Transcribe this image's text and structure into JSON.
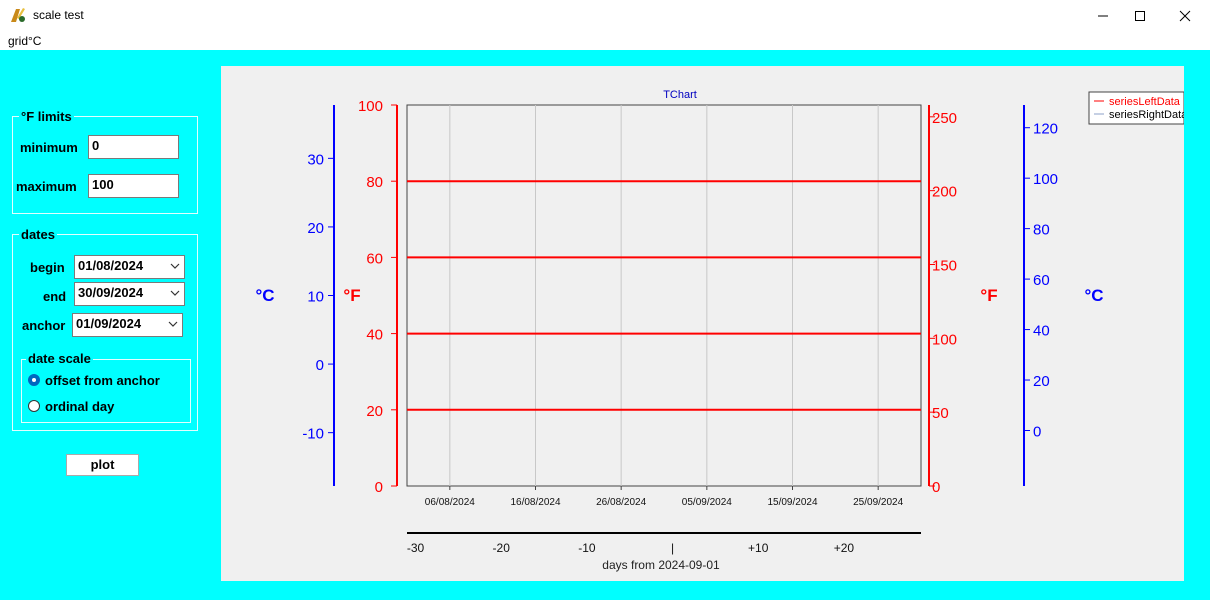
{
  "window": {
    "title": "scale test"
  },
  "menu": {
    "item": "grid°C"
  },
  "f_limits": {
    "legend": "°F limits",
    "minimum_label": "minimum",
    "minimum_value": "0",
    "maximum_label": "maximum",
    "maximum_value": "100"
  },
  "dates": {
    "legend": "dates",
    "begin_label": "begin",
    "begin_value": "01/08/2024",
    "end_label": "end",
    "end_value": "30/09/2024",
    "anchor_label": "anchor",
    "anchor_value": "01/09/2024"
  },
  "date_scale": {
    "legend": "date scale",
    "options": [
      "offset from anchor",
      "ordinal day"
    ],
    "selected": "offset from anchor"
  },
  "plot_button": "plot",
  "colors": {
    "background": "#00ffff",
    "fahrenheit": "#ff0000",
    "celsius": "#0000ff"
  },
  "chart_data": {
    "type": "line",
    "title": "TChart",
    "left_axes": [
      {
        "label": "°C",
        "ticks": [
          30,
          20,
          10,
          0,
          -10
        ],
        "color": "#0000ff"
      },
      {
        "label": "°F",
        "ticks": [
          100,
          80,
          60,
          40,
          20,
          0
        ],
        "range": [
          0,
          100
        ],
        "color": "#ff0000"
      }
    ],
    "right_axes": [
      {
        "label": "°F",
        "ticks": [
          250,
          200,
          150,
          100,
          50,
          0
        ],
        "color": "#ff0000"
      },
      {
        "label": "°C",
        "ticks": [
          120,
          100,
          80,
          60,
          40,
          20,
          0
        ],
        "color": "#0000ff"
      }
    ],
    "x_dates": [
      "06/08/2024",
      "16/08/2024",
      "26/08/2024",
      "05/09/2024",
      "15/09/2024",
      "25/09/2024"
    ],
    "x_range": [
      "01/08/2024",
      "30/09/2024"
    ],
    "horizontal_lines_F": [
      80,
      60,
      40,
      20
    ],
    "offset_axis": {
      "ticks": [
        "-30",
        "-20",
        "-10",
        "|",
        "+10",
        "+20"
      ],
      "label": "days from 2024-09-01"
    },
    "series": [
      {
        "name": "seriesLeftData",
        "color": "#ff0000"
      },
      {
        "name": "seriesRightData",
        "color": "#8ca0c8"
      }
    ],
    "legend_position": "top-right",
    "grid": true
  }
}
